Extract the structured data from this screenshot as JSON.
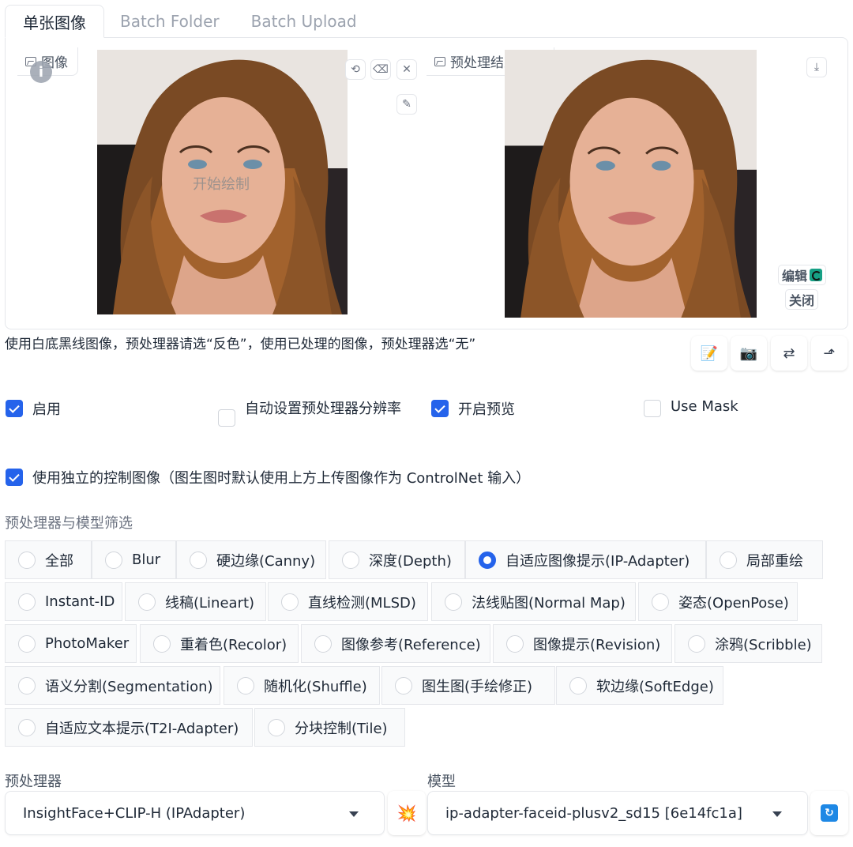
{
  "tabs": [
    {
      "label": "单张图像",
      "active": true
    },
    {
      "label": "Batch Folder",
      "active": false
    },
    {
      "label": "Batch Upload",
      "active": false
    }
  ],
  "input_image": {
    "label": "图像",
    "draw_hint": "开始绘制",
    "info_glyph": "i",
    "icons": [
      "undo-icon",
      "eraser-icon",
      "close-icon",
      "brush-icon"
    ]
  },
  "preview_image": {
    "label": "预处理结果预览",
    "edit_label": "编辑",
    "close_label": "关闭",
    "icons": [
      "download-icon"
    ]
  },
  "hint_text": "使用白底黑线图像，预处理器请选“反色”，使用已处理的图像，预处理器选“无”",
  "toolbar": {
    "buttons": [
      {
        "name": "new-canvas-icon",
        "glyph": "📝"
      },
      {
        "name": "camera-icon",
        "glyph": "📷"
      },
      {
        "name": "swap-icon",
        "glyph": "⇄"
      },
      {
        "name": "send-dimensions-icon",
        "glyph": "⬏"
      }
    ]
  },
  "options": {
    "enable": {
      "label": "启用",
      "checked": true
    },
    "auto_resolution": {
      "label": "自动设置预处理器分辨率",
      "checked": false
    },
    "preview": {
      "label": "开启预览",
      "checked": true
    },
    "use_mask": {
      "label": "Use Mask",
      "checked": false
    },
    "independent_image": {
      "label": "使用独立的控制图像（图生图时默认使用上方上传图像作为 ControlNet 输入）",
      "checked": true
    }
  },
  "filter": {
    "title": "预处理器与模型筛选",
    "selected": "自适应图像提示(IP-Adapter)",
    "items": [
      "全部",
      "Blur",
      "硬边缘(Canny)",
      "深度(Depth)",
      "自适应图像提示(IP-Adapter)",
      "局部重绘",
      "Instant-ID",
      "线稿(Lineart)",
      "直线检测(MLSD)",
      "法线贴图(Normal Map)",
      "姿态(OpenPose)",
      "PhotoMaker",
      "重着色(Recolor)",
      "图像参考(Reference)",
      "图像提示(Revision)",
      "涂鸦(Scribble)",
      "语义分割(Segmentation)",
      "随机化(Shuffle)",
      "图生图(手绘修正)",
      "软边缘(SoftEdge)",
      "自适应文本提示(T2I-Adapter)",
      "分块控制(Tile)"
    ]
  },
  "preprocessor": {
    "label": "预处理器",
    "value": "InsightFace+CLIP-H (IPAdapter)",
    "run_icon": "💥"
  },
  "model": {
    "label": "模型",
    "value": "ip-adapter-faceid-plusv2_sd15 [6e14fc1a]",
    "refresh_icon": "🔄"
  },
  "colors": {
    "accent": "#2563eb",
    "border": "#e5e7eb",
    "muted": "#9ca3af"
  }
}
